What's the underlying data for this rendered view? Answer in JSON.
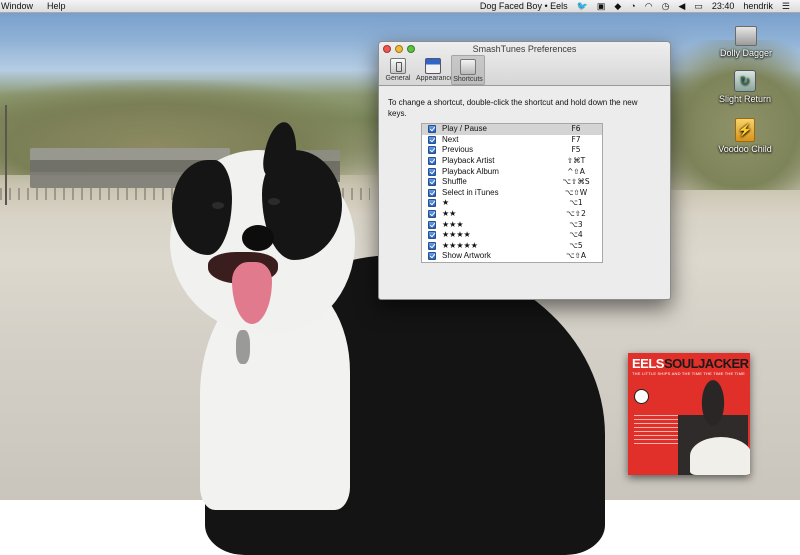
{
  "menubar": {
    "left_items": [
      "Window",
      "Help"
    ],
    "now_playing": "Dog Faced Boy • Eels",
    "clock": "23:40",
    "user": "hendrik",
    "status_icons": [
      "twitter-icon",
      "notifications-icon",
      "dropbox-icon",
      "gauge-icon",
      "wifi-icon",
      "time-machine-icon",
      "volume-icon",
      "battery-icon"
    ]
  },
  "desktop": {
    "icons": [
      {
        "label": "Dolly Dagger",
        "icon": "hard-drive-icon"
      },
      {
        "label": "Slight Return",
        "icon": "time-machine-drive-icon"
      },
      {
        "label": "Voodoo Child",
        "icon": "usb-drive-icon"
      }
    ]
  },
  "album": {
    "title_part1": "EELS",
    "title_part2": "SOULJACKER",
    "subtitle": "THE LITTLE SHIPS AND THE TIME THE TIME THE TIME"
  },
  "window": {
    "title": "SmashTunes Preferences",
    "toolbar": [
      {
        "label": "General",
        "icon": "general-icon",
        "active": false
      },
      {
        "label": "Appearance",
        "icon": "appearance-icon",
        "active": false
      },
      {
        "label": "Shortcuts",
        "icon": "shortcuts-icon",
        "active": true
      }
    ],
    "instructions": "To change a shortcut, double-click the shortcut and hold down the new keys.",
    "shortcuts": [
      {
        "action": "Play / Pause",
        "key": "F6",
        "checked": true,
        "selected": true
      },
      {
        "action": "Next",
        "key": "F7",
        "checked": true
      },
      {
        "action": "Previous",
        "key": "F5",
        "checked": true
      },
      {
        "action": "Playback Artist",
        "key": "⇧⌘T",
        "checked": true
      },
      {
        "action": "Playback Album",
        "key": "^⇧A",
        "checked": true
      },
      {
        "action": "Shuffle",
        "key": "⌥⇧⌘S",
        "checked": true
      },
      {
        "action": "Select in iTunes",
        "key": "⌥⇧W",
        "checked": true
      },
      {
        "action": "★",
        "key": "⌥1",
        "checked": true
      },
      {
        "action": "★★",
        "key": "⌥⇧2",
        "checked": true
      },
      {
        "action": "★★★",
        "key": "⌥3",
        "checked": true
      },
      {
        "action": "★★★★",
        "key": "⌥4",
        "checked": true
      },
      {
        "action": "★★★★★",
        "key": "⌥5",
        "checked": true
      },
      {
        "action": "Show Artwork",
        "key": "⌥⇧A",
        "checked": true
      }
    ]
  }
}
